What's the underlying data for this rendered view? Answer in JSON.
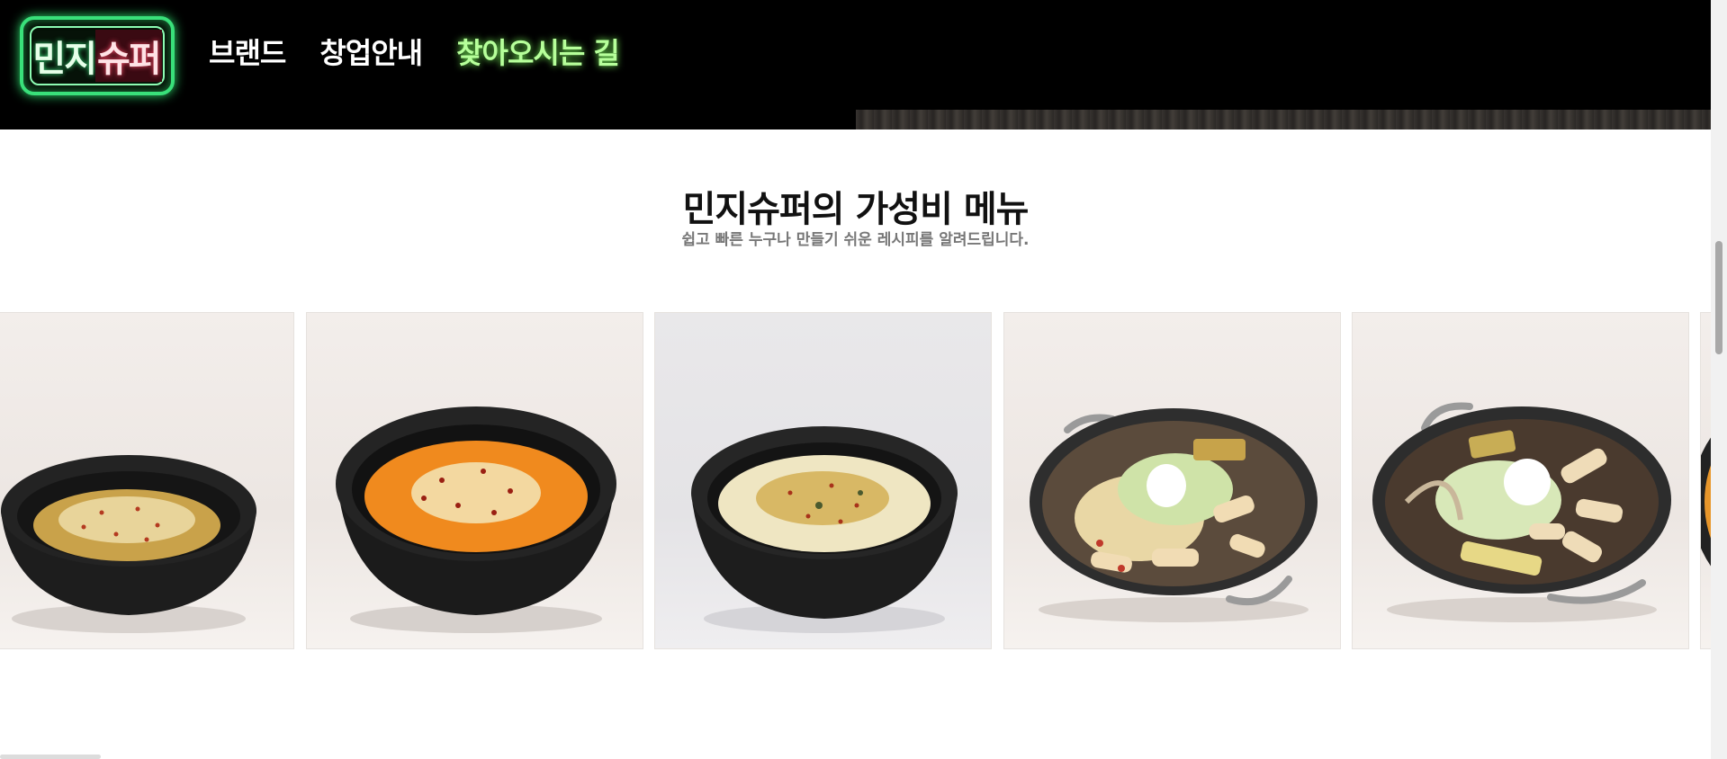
{
  "logo": {
    "text_a": "민지",
    "text_b": "슈퍼"
  },
  "nav": {
    "items": [
      {
        "label": "브랜드"
      },
      {
        "label": "창업안내"
      },
      {
        "label": "찾아오시는 길"
      }
    ]
  },
  "section": {
    "title": "민지슈퍼의 가성비 메뉴",
    "subtitle": "쉽고 빠른 누구나 만들기 쉬운 레시피를 알려드립니다."
  },
  "menu_cards": [
    {
      "icon": "pasta-bowl-icon"
    },
    {
      "icon": "rose-pasta-bowl-icon"
    },
    {
      "icon": "cream-pasta-bowl-icon"
    },
    {
      "icon": "tteokbokki-pan-icon"
    },
    {
      "icon": "rabokki-pan-icon"
    },
    {
      "icon": "dish-icon"
    }
  ],
  "colors": {
    "header_bg": "#000000",
    "nav_active": "#b6ff9a",
    "logo_neon": "#39e07a"
  }
}
